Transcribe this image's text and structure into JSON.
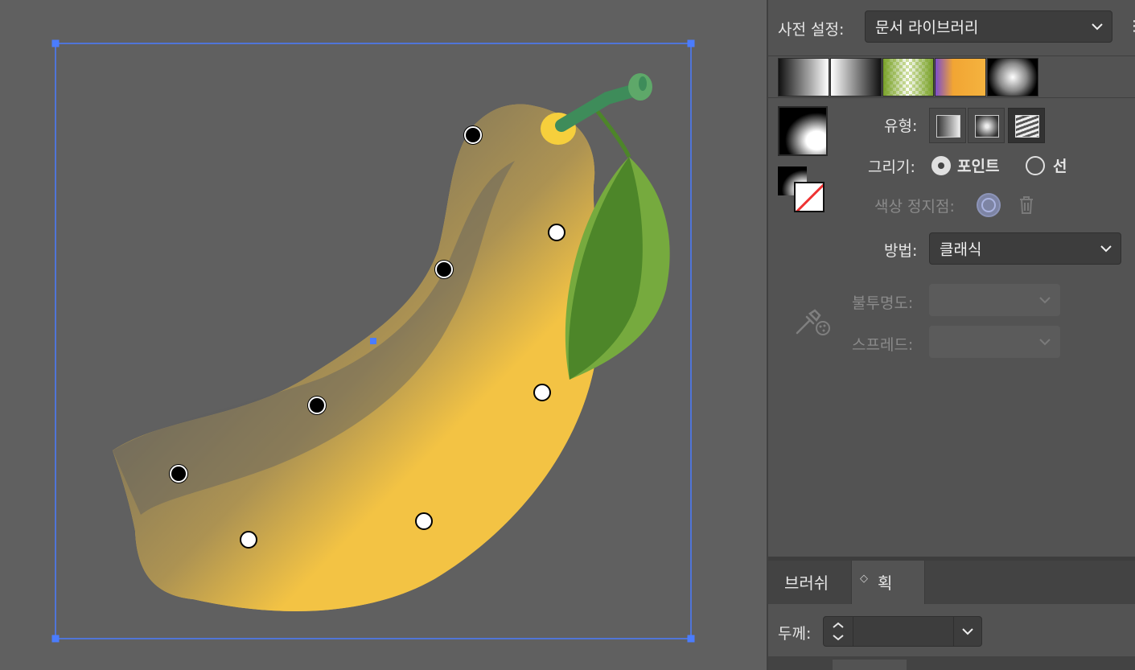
{
  "canvas": {
    "accent": "#4a7cff",
    "fill_yellow": "#f3c344",
    "leaf_dark": "#4d8629",
    "leaf_light": "#76aa3e",
    "stem": "#3e8c5a"
  },
  "gradient_panel": {
    "preset_label": "사전 설정:",
    "preset_value": "문서 라이브러리",
    "type_label": "유형:",
    "draw_label": "그리기:",
    "draw_options": [
      {
        "label": "포인트",
        "selected": true
      },
      {
        "label": "선",
        "selected": false
      }
    ],
    "color_stop_label": "색상 정지점:",
    "method_label": "방법:",
    "method_value": "클래식",
    "opacity_label": "불투명도:",
    "spread_label": "스프레드:"
  },
  "stroke_panel": {
    "tabs": [
      {
        "label": "브러쉬",
        "active": false
      },
      {
        "label": "획",
        "active": true
      }
    ],
    "weight_label": "두께:",
    "weight_value": ""
  }
}
